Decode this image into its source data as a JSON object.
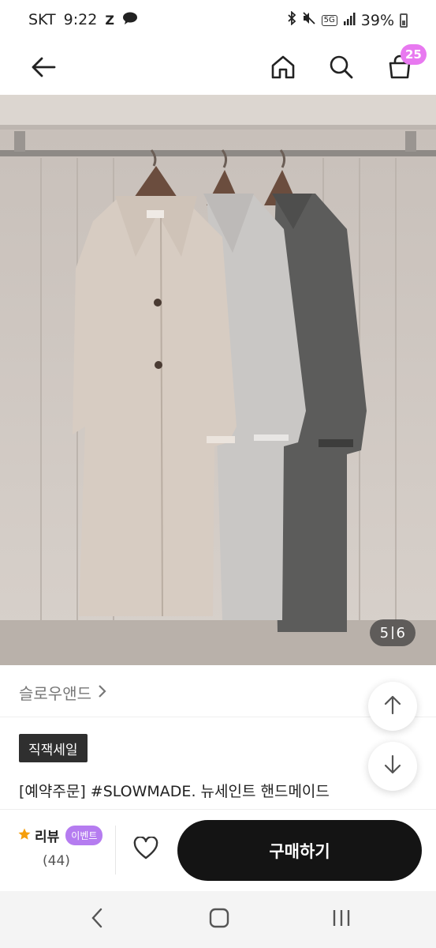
{
  "status_bar": {
    "carrier": "SKT",
    "time": "9:22",
    "notif_icons": [
      "z-app-icon",
      "chat-icon"
    ],
    "network": "5G",
    "battery": "39%"
  },
  "header": {
    "icons": [
      "back-arrow-icon",
      "home-icon",
      "search-icon",
      "cart-icon"
    ],
    "cart_count": "25"
  },
  "product_image": {
    "current": "5",
    "total": "6",
    "colors": {
      "coat_beige": "#d7ccc2",
      "coat_grey": "#c9c7c5",
      "coat_charcoal": "#595958",
      "wall": "#cfc7c0"
    }
  },
  "brand": {
    "name": "슬로우앤드"
  },
  "product": {
    "badge": "직잭세일",
    "title": "[예약주문] #SLOWMADE. 뉴세인트 핸드메이드"
  },
  "buy_bar": {
    "review_label": "리뷰",
    "event_label": "이벤트",
    "review_count": "(44)",
    "buy_label": "구매하기"
  },
  "colors": {
    "accent_badge": "#e879f0",
    "event_badge": "#b57cf0",
    "buy_button": "#141414",
    "star": "#f59e0b"
  }
}
